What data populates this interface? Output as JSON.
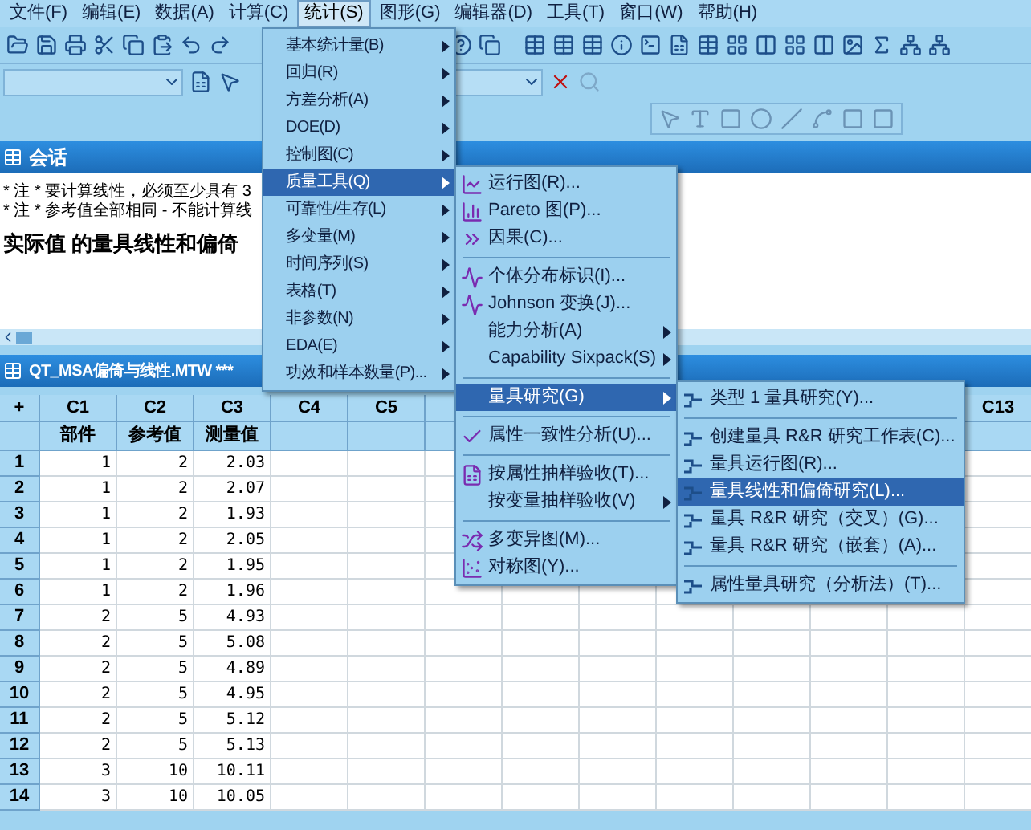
{
  "menu_bar": [
    {
      "label": "文件(F)",
      "selected": false
    },
    {
      "label": "编辑(E)",
      "selected": false
    },
    {
      "label": "数据(A)",
      "selected": false
    },
    {
      "label": "计算(C)",
      "selected": false
    },
    {
      "label": "统计(S)",
      "selected": true
    },
    {
      "label": "图形(G)",
      "selected": false
    },
    {
      "label": "编辑器(D)",
      "selected": false
    },
    {
      "label": "工具(T)",
      "selected": false
    },
    {
      "label": "窗口(W)",
      "selected": false
    },
    {
      "label": "帮助(H)",
      "selected": false
    }
  ],
  "session": {
    "title": "会话",
    "lines": [
      "* 注 * 要计算线性，必须至少具有 3",
      "* 注 * 参考值全部相同 - 不能计算线"
    ],
    "heading": "实际值 的量具线性和偏倚"
  },
  "worksheet": {
    "title": "QT_MSA偏倚与线性.MTW ***",
    "corner": "+",
    "columns": [
      {
        "id": "C1",
        "name": "部件"
      },
      {
        "id": "C2",
        "name": "参考值"
      },
      {
        "id": "C3",
        "name": "测量值"
      },
      {
        "id": "C4"
      },
      {
        "id": "C5"
      }
    ],
    "last_column": "C13",
    "rows": [
      {
        "number": "1",
        "cells": [
          "1",
          "2",
          "2.03"
        ]
      },
      {
        "number": "2",
        "cells": [
          "1",
          "2",
          "2.07"
        ]
      },
      {
        "number": "3",
        "cells": [
          "1",
          "2",
          "1.93"
        ]
      },
      {
        "number": "4",
        "cells": [
          "1",
          "2",
          "2.05"
        ]
      },
      {
        "number": "5",
        "cells": [
          "1",
          "2",
          "1.95"
        ]
      },
      {
        "number": "6",
        "cells": [
          "1",
          "2",
          "1.96"
        ]
      },
      {
        "number": "7",
        "cells": [
          "2",
          "5",
          "4.93"
        ]
      },
      {
        "number": "8",
        "cells": [
          "2",
          "5",
          "5.08"
        ]
      },
      {
        "number": "9",
        "cells": [
          "2",
          "5",
          "4.89"
        ]
      },
      {
        "number": "10",
        "cells": [
          "2",
          "5",
          "4.95"
        ]
      },
      {
        "number": "11",
        "cells": [
          "2",
          "5",
          "5.12"
        ]
      },
      {
        "number": "12",
        "cells": [
          "2",
          "5",
          "5.13"
        ]
      },
      {
        "number": "13",
        "cells": [
          "3",
          "10",
          "10.11"
        ]
      },
      {
        "number": "14",
        "cells": [
          "3",
          "10",
          "10.05"
        ]
      }
    ]
  },
  "menus": [
    {
      "items": [
        {
          "kind": "item",
          "label": "基本统计量(B)",
          "submenu": true,
          "selected": false
        },
        {
          "kind": "item",
          "label": "回归(R)",
          "submenu": true,
          "selected": false
        },
        {
          "kind": "item",
          "label": "方差分析(A)",
          "submenu": true,
          "selected": false
        },
        {
          "kind": "item",
          "label": "DOE(D)",
          "submenu": true,
          "selected": false
        },
        {
          "kind": "item",
          "label": "控制图(C)",
          "submenu": true,
          "selected": false
        },
        {
          "kind": "item",
          "label": "质量工具(Q)",
          "submenu": true,
          "selected": true
        },
        {
          "kind": "item",
          "label": "可靠性/生存(L)",
          "submenu": true,
          "selected": false
        },
        {
          "kind": "item",
          "label": "多变量(M)",
          "submenu": true,
          "selected": false
        },
        {
          "kind": "item",
          "label": "时间序列(S)",
          "submenu": true,
          "selected": false
        },
        {
          "kind": "item",
          "label": "表格(T)",
          "submenu": true,
          "selected": false
        },
        {
          "kind": "item",
          "label": "非参数(N)",
          "submenu": true,
          "selected": false
        },
        {
          "kind": "item",
          "label": "EDA(E)",
          "submenu": true,
          "selected": false
        },
        {
          "kind": "item",
          "label": "功效和样本数量(P)...",
          "submenu": true,
          "selected": false
        }
      ]
    },
    {
      "items": [
        {
          "kind": "item",
          "label": "运行图(R)...",
          "submenu": false,
          "selected": false
        },
        {
          "kind": "item",
          "label": "Pareto 图(P)...",
          "submenu": false,
          "selected": false
        },
        {
          "kind": "item",
          "label": "因果(C)...",
          "submenu": false,
          "selected": false
        },
        {
          "kind": "separator"
        },
        {
          "kind": "item",
          "label": "个体分布标识(I)...",
          "submenu": false,
          "selected": false
        },
        {
          "kind": "item",
          "label": "Johnson 变换(J)...",
          "submenu": false,
          "selected": false
        },
        {
          "kind": "item",
          "label": "能力分析(A)",
          "submenu": true,
          "selected": false
        },
        {
          "kind": "item",
          "label": "Capability Sixpack(S)",
          "submenu": true,
          "selected": false
        },
        {
          "kind": "separator"
        },
        {
          "kind": "item",
          "label": "量具研究(G)",
          "submenu": true,
          "selected": true
        },
        {
          "kind": "separator"
        },
        {
          "kind": "item",
          "label": "属性一致性分析(U)...",
          "submenu": false,
          "selected": false
        },
        {
          "kind": "separator"
        },
        {
          "kind": "item",
          "label": "按属性抽样验收(T)...",
          "submenu": false,
          "selected": false
        },
        {
          "kind": "item",
          "label": "按变量抽样验收(V)",
          "submenu": true,
          "selected": false
        },
        {
          "kind": "separator"
        },
        {
          "kind": "item",
          "label": "多变异图(M)...",
          "submenu": false,
          "selected": false
        },
        {
          "kind": "item",
          "label": "对称图(Y)...",
          "submenu": false,
          "selected": false
        }
      ]
    },
    {
      "items": [
        {
          "kind": "item",
          "label": "类型 1 量具研究(Y)...",
          "submenu": false,
          "selected": false
        },
        {
          "kind": "separator"
        },
        {
          "kind": "item",
          "label": "创建量具 R&R 研究工作表(C)...",
          "submenu": false,
          "selected": false
        },
        {
          "kind": "item",
          "label": "量具运行图(R)...",
          "submenu": false,
          "selected": false
        },
        {
          "kind": "item",
          "label": "量具线性和偏倚研究(L)...",
          "submenu": false,
          "selected": true
        },
        {
          "kind": "item",
          "label": "量具 R&R 研究（交叉）(G)...",
          "submenu": false,
          "selected": false
        },
        {
          "kind": "item",
          "label": "量具 R&R 研究（嵌套）(A)...",
          "submenu": false,
          "selected": false
        },
        {
          "kind": "separator"
        },
        {
          "kind": "item",
          "label": "属性量具研究（分析法）(T)...",
          "submenu": false,
          "selected": false
        }
      ]
    }
  ]
}
